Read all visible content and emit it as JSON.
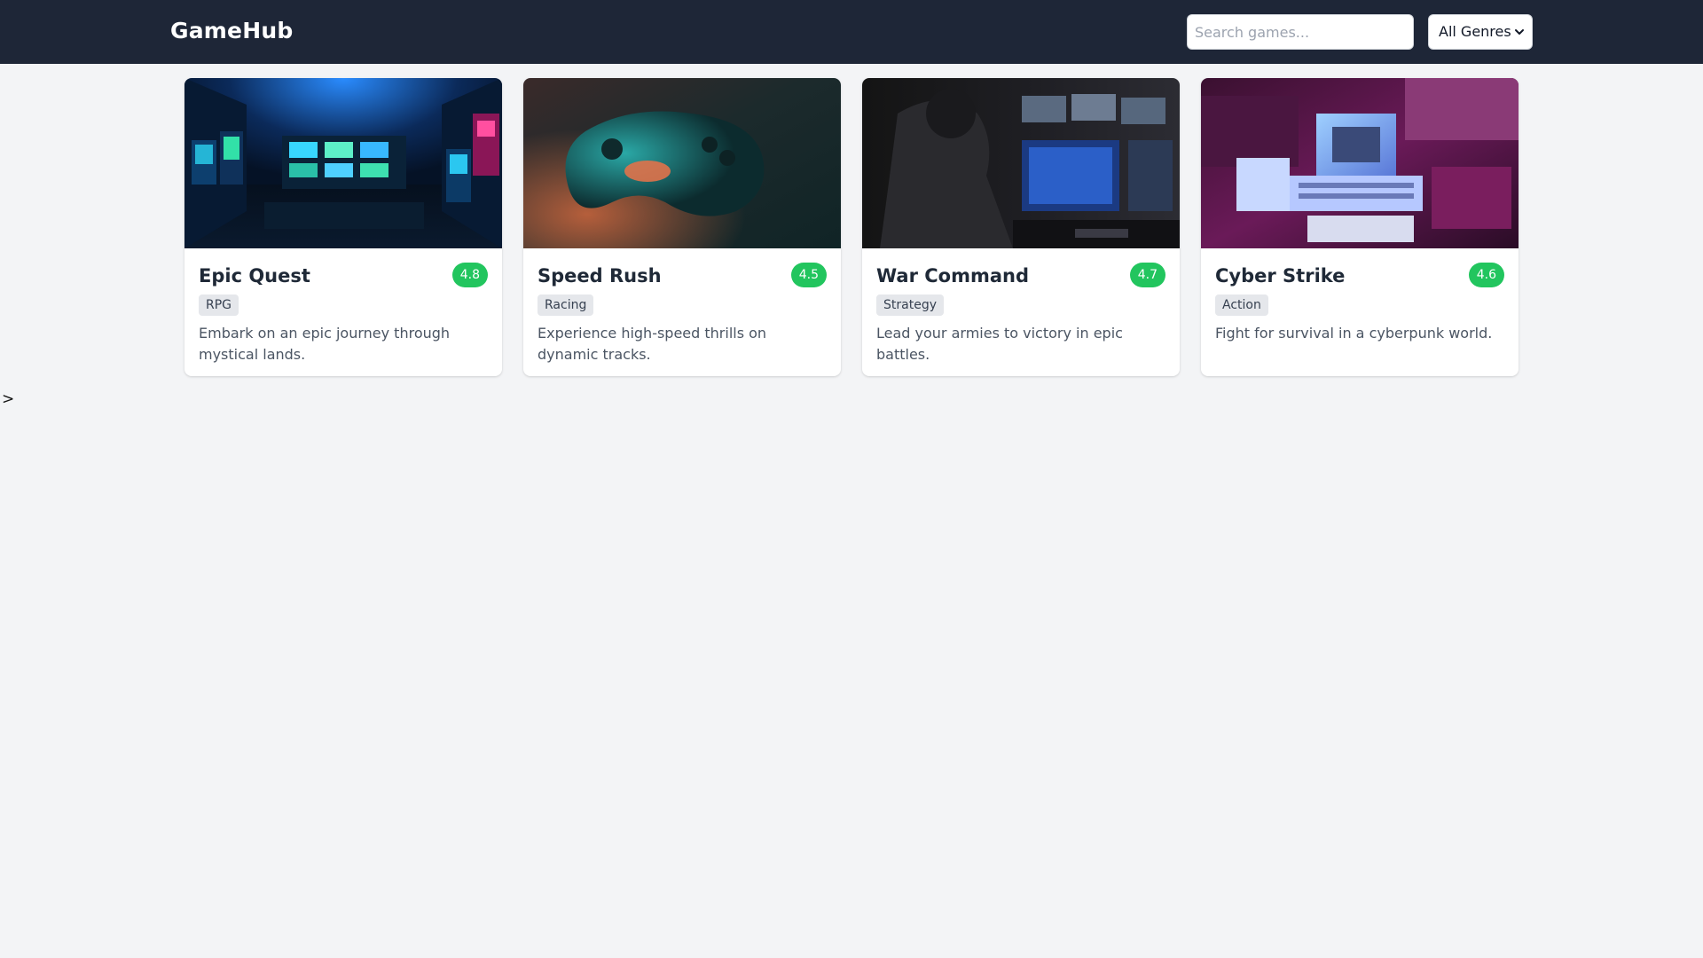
{
  "header": {
    "brand": "GameHub",
    "search": {
      "placeholder": "Search games...",
      "value": ""
    },
    "genre_filter": {
      "selected": "All Genres"
    }
  },
  "games": [
    {
      "title": "Epic Quest",
      "rating": "4.8",
      "genre": "RPG",
      "description": "Embark on an epic journey through mystical lands.",
      "image_theme": "arcade-room"
    },
    {
      "title": "Speed Rush",
      "rating": "4.5",
      "genre": "Racing",
      "description": "Experience high-speed thrills on dynamic tracks.",
      "image_theme": "gamepad"
    },
    {
      "title": "War Command",
      "rating": "4.7",
      "genre": "Strategy",
      "description": "Lead your armies to victory in epic battles.",
      "image_theme": "gaming-setup"
    },
    {
      "title": "Cyber Strike",
      "rating": "4.6",
      "genre": "Action",
      "description": "Fight for survival in a cyberpunk world.",
      "image_theme": "retro-computers"
    }
  ],
  "stray_text": ">",
  "colors": {
    "navbar": "#1e2637",
    "rating_badge": "#22c55e",
    "page_background": "#f3f4f6"
  }
}
